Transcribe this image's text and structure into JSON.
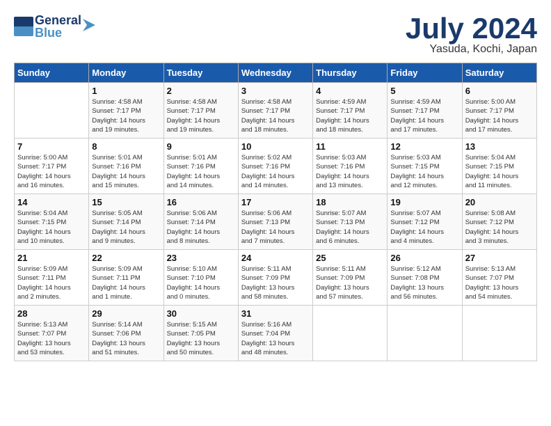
{
  "header": {
    "logo_general": "General",
    "logo_blue": "Blue",
    "month": "July 2024",
    "location": "Yasuda, Kochi, Japan"
  },
  "days_of_week": [
    "Sunday",
    "Monday",
    "Tuesday",
    "Wednesday",
    "Thursday",
    "Friday",
    "Saturday"
  ],
  "weeks": [
    [
      {
        "day": "",
        "info": ""
      },
      {
        "day": "1",
        "info": "Sunrise: 4:58 AM\nSunset: 7:17 PM\nDaylight: 14 hours\nand 19 minutes."
      },
      {
        "day": "2",
        "info": "Sunrise: 4:58 AM\nSunset: 7:17 PM\nDaylight: 14 hours\nand 19 minutes."
      },
      {
        "day": "3",
        "info": "Sunrise: 4:58 AM\nSunset: 7:17 PM\nDaylight: 14 hours\nand 18 minutes."
      },
      {
        "day": "4",
        "info": "Sunrise: 4:59 AM\nSunset: 7:17 PM\nDaylight: 14 hours\nand 18 minutes."
      },
      {
        "day": "5",
        "info": "Sunrise: 4:59 AM\nSunset: 7:17 PM\nDaylight: 14 hours\nand 17 minutes."
      },
      {
        "day": "6",
        "info": "Sunrise: 5:00 AM\nSunset: 7:17 PM\nDaylight: 14 hours\nand 17 minutes."
      }
    ],
    [
      {
        "day": "7",
        "info": "Sunrise: 5:00 AM\nSunset: 7:17 PM\nDaylight: 14 hours\nand 16 minutes."
      },
      {
        "day": "8",
        "info": "Sunrise: 5:01 AM\nSunset: 7:16 PM\nDaylight: 14 hours\nand 15 minutes."
      },
      {
        "day": "9",
        "info": "Sunrise: 5:01 AM\nSunset: 7:16 PM\nDaylight: 14 hours\nand 14 minutes."
      },
      {
        "day": "10",
        "info": "Sunrise: 5:02 AM\nSunset: 7:16 PM\nDaylight: 14 hours\nand 14 minutes."
      },
      {
        "day": "11",
        "info": "Sunrise: 5:03 AM\nSunset: 7:16 PM\nDaylight: 14 hours\nand 13 minutes."
      },
      {
        "day": "12",
        "info": "Sunrise: 5:03 AM\nSunset: 7:15 PM\nDaylight: 14 hours\nand 12 minutes."
      },
      {
        "day": "13",
        "info": "Sunrise: 5:04 AM\nSunset: 7:15 PM\nDaylight: 14 hours\nand 11 minutes."
      }
    ],
    [
      {
        "day": "14",
        "info": "Sunrise: 5:04 AM\nSunset: 7:15 PM\nDaylight: 14 hours\nand 10 minutes."
      },
      {
        "day": "15",
        "info": "Sunrise: 5:05 AM\nSunset: 7:14 PM\nDaylight: 14 hours\nand 9 minutes."
      },
      {
        "day": "16",
        "info": "Sunrise: 5:06 AM\nSunset: 7:14 PM\nDaylight: 14 hours\nand 8 minutes."
      },
      {
        "day": "17",
        "info": "Sunrise: 5:06 AM\nSunset: 7:13 PM\nDaylight: 14 hours\nand 7 minutes."
      },
      {
        "day": "18",
        "info": "Sunrise: 5:07 AM\nSunset: 7:13 PM\nDaylight: 14 hours\nand 6 minutes."
      },
      {
        "day": "19",
        "info": "Sunrise: 5:07 AM\nSunset: 7:12 PM\nDaylight: 14 hours\nand 4 minutes."
      },
      {
        "day": "20",
        "info": "Sunrise: 5:08 AM\nSunset: 7:12 PM\nDaylight: 14 hours\nand 3 minutes."
      }
    ],
    [
      {
        "day": "21",
        "info": "Sunrise: 5:09 AM\nSunset: 7:11 PM\nDaylight: 14 hours\nand 2 minutes."
      },
      {
        "day": "22",
        "info": "Sunrise: 5:09 AM\nSunset: 7:11 PM\nDaylight: 14 hours\nand 1 minute."
      },
      {
        "day": "23",
        "info": "Sunrise: 5:10 AM\nSunset: 7:10 PM\nDaylight: 14 hours\nand 0 minutes."
      },
      {
        "day": "24",
        "info": "Sunrise: 5:11 AM\nSunset: 7:09 PM\nDaylight: 13 hours\nand 58 minutes."
      },
      {
        "day": "25",
        "info": "Sunrise: 5:11 AM\nSunset: 7:09 PM\nDaylight: 13 hours\nand 57 minutes."
      },
      {
        "day": "26",
        "info": "Sunrise: 5:12 AM\nSunset: 7:08 PM\nDaylight: 13 hours\nand 56 minutes."
      },
      {
        "day": "27",
        "info": "Sunrise: 5:13 AM\nSunset: 7:07 PM\nDaylight: 13 hours\nand 54 minutes."
      }
    ],
    [
      {
        "day": "28",
        "info": "Sunrise: 5:13 AM\nSunset: 7:07 PM\nDaylight: 13 hours\nand 53 minutes."
      },
      {
        "day": "29",
        "info": "Sunrise: 5:14 AM\nSunset: 7:06 PM\nDaylight: 13 hours\nand 51 minutes."
      },
      {
        "day": "30",
        "info": "Sunrise: 5:15 AM\nSunset: 7:05 PM\nDaylight: 13 hours\nand 50 minutes."
      },
      {
        "day": "31",
        "info": "Sunrise: 5:16 AM\nSunset: 7:04 PM\nDaylight: 13 hours\nand 48 minutes."
      },
      {
        "day": "",
        "info": ""
      },
      {
        "day": "",
        "info": ""
      },
      {
        "day": "",
        "info": ""
      }
    ]
  ]
}
